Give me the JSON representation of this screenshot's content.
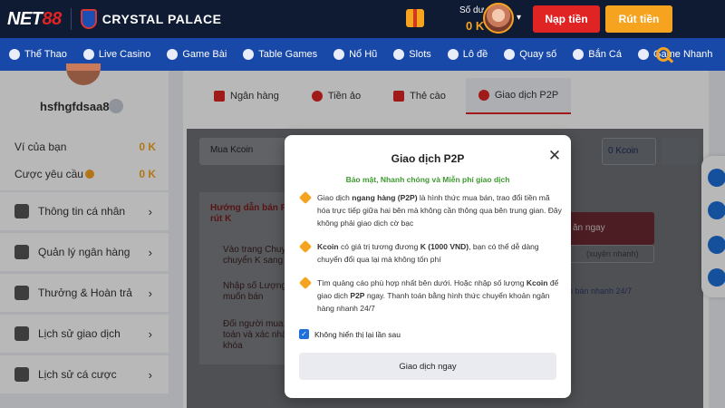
{
  "header": {
    "logo_part1": "NET",
    "logo_part2": "88",
    "club_name": "CRYSTAL PALACE",
    "balance_label": "Số dư",
    "balance_value": "0 K",
    "deposit_label": "Nạp tiền",
    "withdraw_label": "Rút tiền"
  },
  "nav": {
    "items": [
      "Thể Thao",
      "Live Casino",
      "Game Bài",
      "Table Games",
      "Nổ Hũ",
      "Slots",
      "Lô đề",
      "Quay số",
      "Bắn Cá",
      "Game Nhanh"
    ]
  },
  "sidebar": {
    "username": "hsfhgfdsaa8",
    "wallet_label": "Ví của bạn",
    "wallet_value": "0 K",
    "bet_label": "Cược yêu cầu",
    "bet_value": "0 K",
    "menu": [
      {
        "label": "Thông tin cá nhân",
        "icon": "user-icon"
      },
      {
        "label": "Quản lý ngân hàng",
        "icon": "bank-icon"
      },
      {
        "label": "Thưởng & Hoàn trả",
        "icon": "gift-icon"
      },
      {
        "label": "Lịch sử giao dịch",
        "icon": "history-icon"
      },
      {
        "label": "Lịch sử cá cược",
        "icon": "history-icon"
      }
    ]
  },
  "tabs": [
    {
      "label": "Ngân hàng",
      "icon": "bank-icon",
      "color": "#e02424"
    },
    {
      "label": "Tiền ảo",
      "icon": "coin-icon",
      "color": "#e02424"
    },
    {
      "label": "Thẻ cào",
      "icon": "card-icon",
      "color": "#e02424"
    },
    {
      "label": "Giao dịch P2P",
      "icon": "p2p-icon",
      "color": "#e02424"
    }
  ],
  "background": {
    "tab1": "Mua Kcoin",
    "kcoin_label": "0 Kcoin",
    "guide_title": "Hướng dẫn bán P2P",
    "guide_title2": "rút K",
    "steps": [
      "Vào trang Chuyển",
      "chuyển K sang K",
      "Nhập số Lượng K",
      "muốn bán",
      "Đối người mua th",
      "toán và xác nhận",
      "khóa"
    ],
    "red_button": "ăn ngay",
    "gray_button": "(xuyên nhanh)",
    "link": "ền bán nhanh 24/7"
  },
  "modal": {
    "title": "Giao dịch P2P",
    "subtitle": "Bảo mật, Nhanh chóng và Miễn phí giao dịch",
    "bullet1_pre": "Giao dịch ",
    "bullet1_bold": "ngang hàng (P2P)",
    "bullet1_post": " là hình thức mua bán, trao đổi tiền mã hóa trực tiếp giữa hai bên mà không cần thông qua bên trung gian. Đây không phải giao dịch cờ bạc",
    "bullet2_bold": "Kcoin",
    "bullet2_mid": " có giá trị tương đương ",
    "bullet2_bold2": "K (1000 VND)",
    "bullet2_post": ", bạn có thể dễ dàng chuyển đổi qua lại mà không tốn phí",
    "bullet3_pre": "Tìm quảng cáo phù hợp nhất bên dưới. Hoặc nhập số lượng ",
    "bullet3_bold": "Kcoin",
    "bullet3_mid": " để giao dịch ",
    "bullet3_bold2": "P2P",
    "bullet3_post": " ngay. Thanh toán bằng hình thức chuyển khoản ngân hàng nhanh 24/7",
    "dont_show": "Không hiển thị lại lần sau",
    "cta": "Giao dịch ngay"
  },
  "colors": {
    "navy": "#0f1a33",
    "nav_blue": "#1849a9",
    "red": "#e02424",
    "orange": "#f6a420",
    "green": "#3c9a2e"
  }
}
